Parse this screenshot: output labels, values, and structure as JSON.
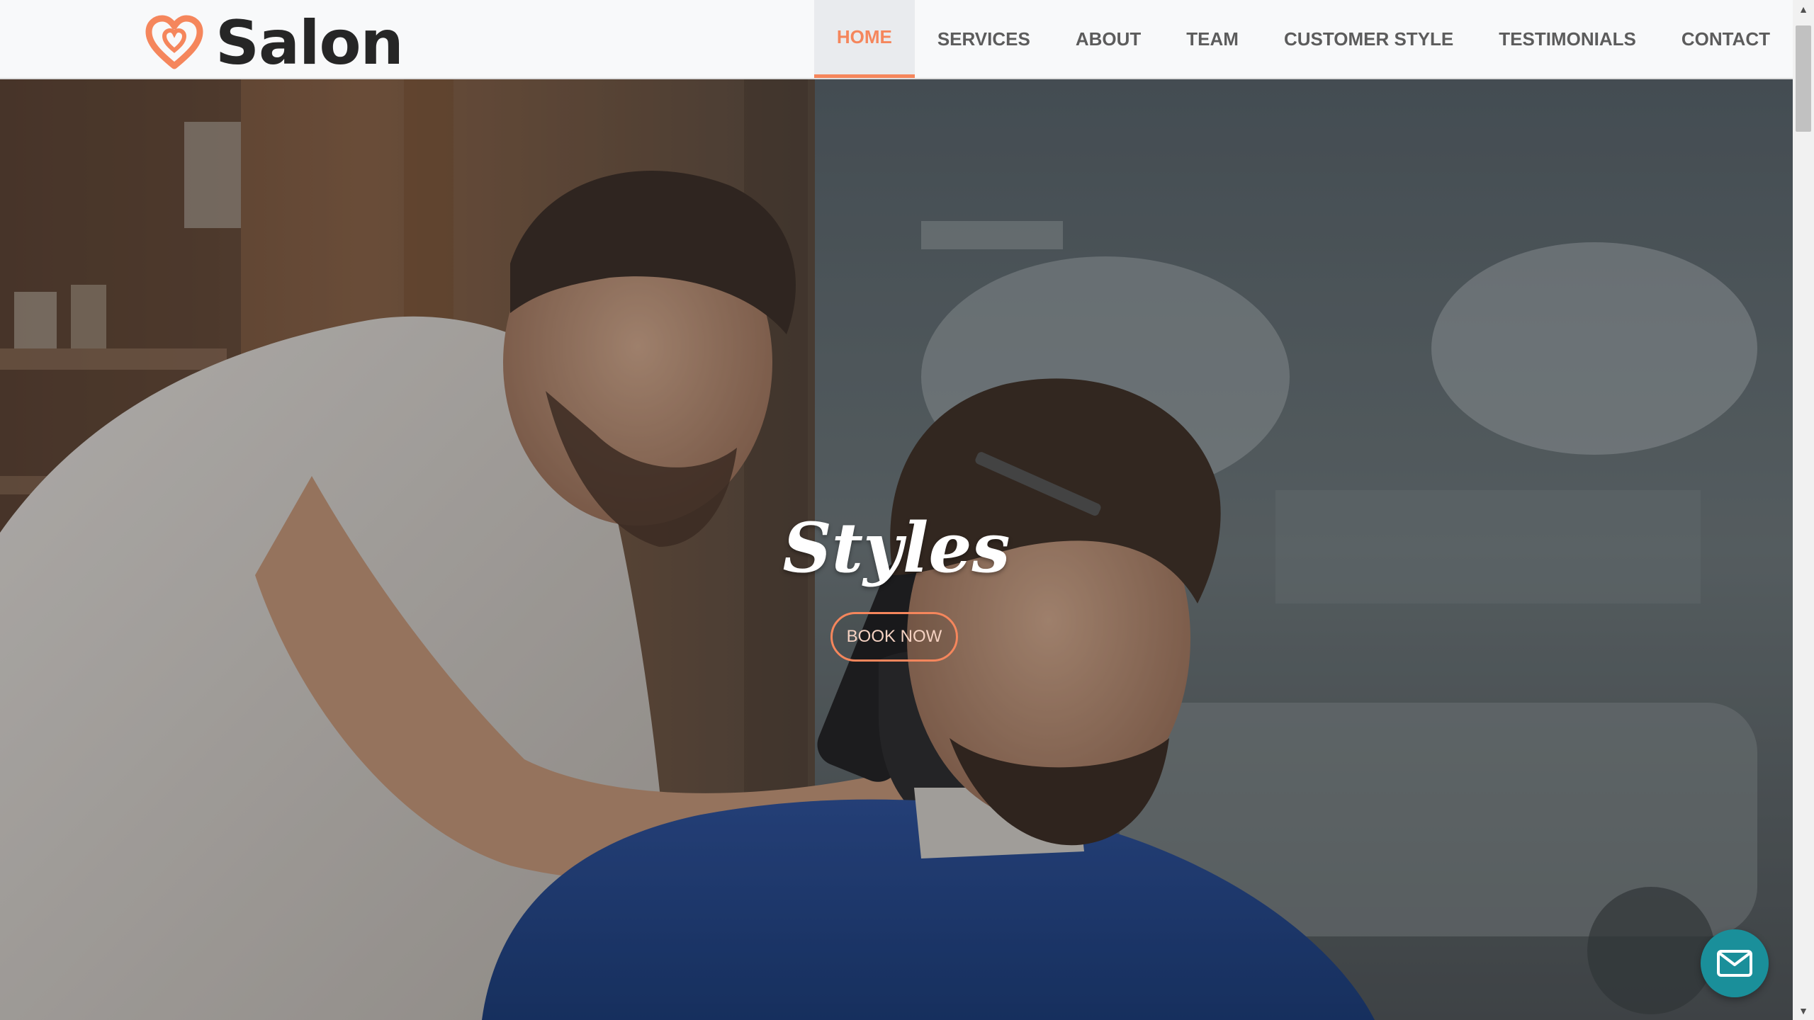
{
  "brand": {
    "name": "Salon",
    "logo_icon": "heart-logo-icon",
    "accent": "#f5865c"
  },
  "nav": {
    "items": [
      {
        "label": "HOME",
        "active": true
      },
      {
        "label": "SERVICES",
        "active": false
      },
      {
        "label": "ABOUT",
        "active": false
      },
      {
        "label": "TEAM",
        "active": false
      },
      {
        "label": "CUSTOMER STYLE",
        "active": false
      },
      {
        "label": "TESTIMONIALS",
        "active": false
      },
      {
        "label": "CONTACT",
        "active": false
      }
    ]
  },
  "hero": {
    "title": "Styles",
    "button_label": "BOOK NOW",
    "image": "barber-cutting-hair-photo"
  },
  "floating": {
    "icon": "envelope-icon",
    "color": "#1a8f9a"
  },
  "scrollbar": {
    "up_icon": "arrow-up-icon",
    "down_icon": "arrow-down-icon",
    "up_glyph": "▲",
    "down_glyph": "▼"
  }
}
